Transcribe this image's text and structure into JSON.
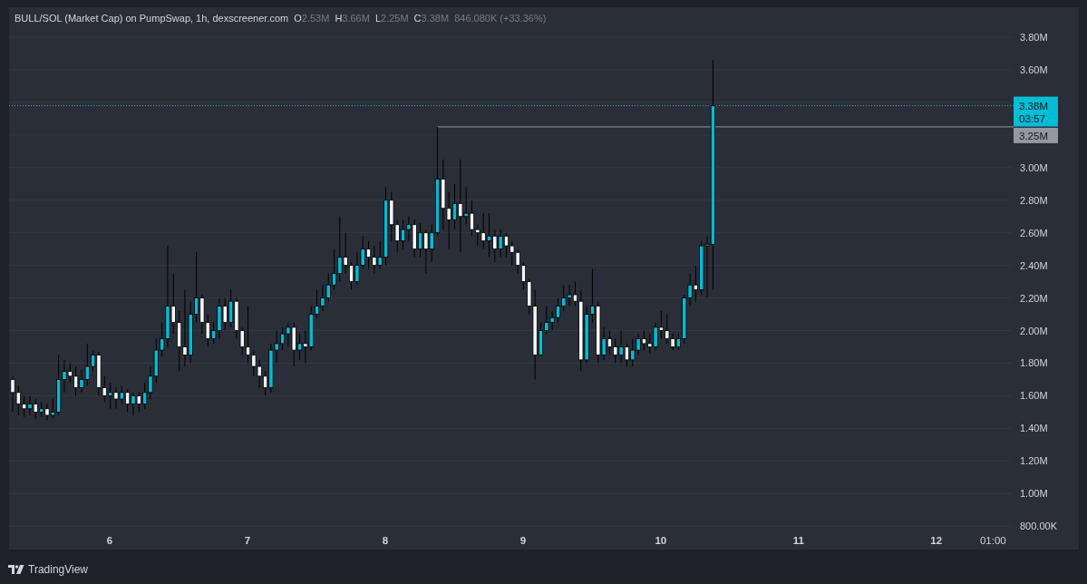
{
  "chart": {
    "header": {
      "title": "BULL/SOL (Market Cap) on PumpSwap, 1h, dexscreener.com",
      "ohlc": [
        {
          "label": "O",
          "value": "2.53M"
        },
        {
          "label": "H",
          "value": "3.66M"
        },
        {
          "label": "L",
          "value": "2.25M"
        },
        {
          "label": "C",
          "value": "3.38M"
        }
      ],
      "change": "846.080K (+33.36%)"
    },
    "price_axis": [
      "3.80M",
      "3.60M",
      "3.00M",
      "2.80M",
      "2.60M",
      "2.40M",
      "2.20M",
      "2.00M",
      "1.80M",
      "1.60M",
      "1.40M",
      "1.20M",
      "1.00M",
      "800.00K"
    ],
    "last_price": {
      "value": "3.38M",
      "countdown": "03:57"
    },
    "line_price": "3.25M",
    "time_axis": [
      "6",
      "7",
      "8",
      "9",
      "10",
      "11",
      "12",
      "01:00"
    ]
  },
  "footer": {
    "brand": "TradingView"
  }
}
